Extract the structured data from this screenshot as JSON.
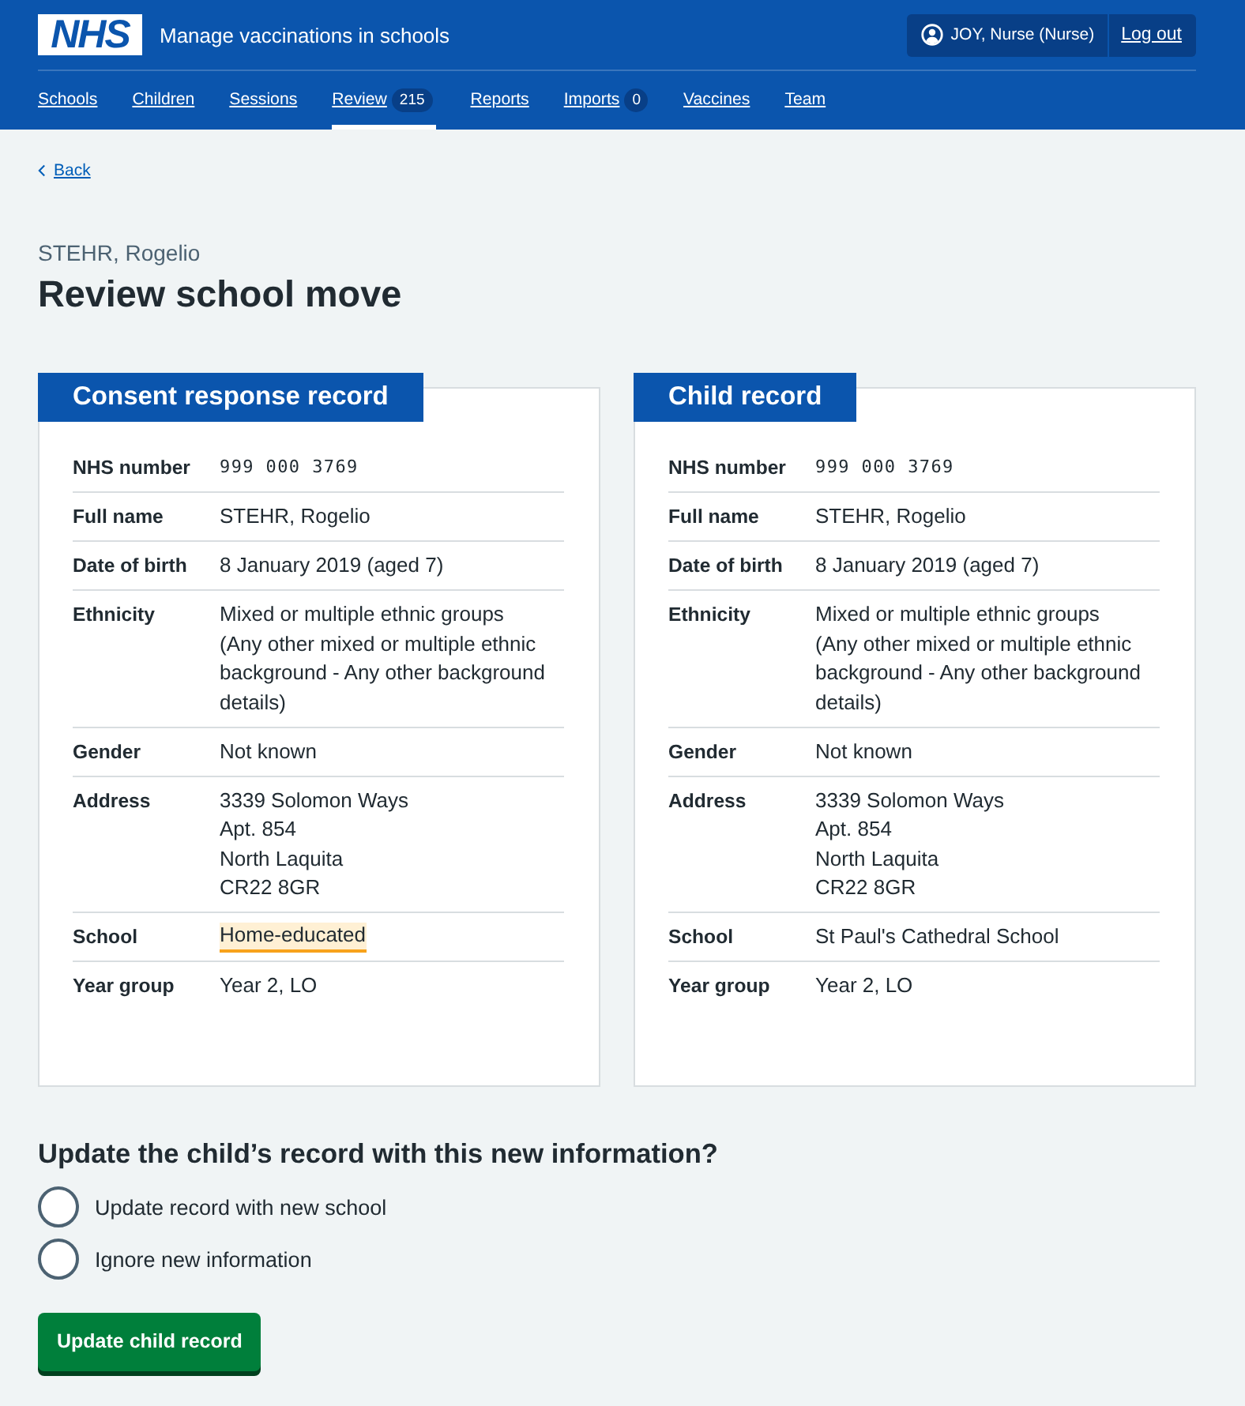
{
  "header": {
    "logo": "NHS",
    "service_name": "Manage vaccinations in schools",
    "account": {
      "user": "JOY, Nurse (Nurse)",
      "logout": "Log out"
    }
  },
  "nav": [
    {
      "label": "Schools",
      "selected": false
    },
    {
      "label": "Children",
      "selected": false
    },
    {
      "label": "Sessions",
      "selected": false
    },
    {
      "label": "Review",
      "count": "215",
      "selected": true
    },
    {
      "label": "Reports",
      "selected": false
    },
    {
      "label": "Imports",
      "count": "0",
      "selected": false
    },
    {
      "label": "Vaccines",
      "selected": false
    },
    {
      "label": "Team",
      "selected": false
    }
  ],
  "back_link": "Back",
  "caption": "STEHR, Rogelio",
  "title": "Review school move",
  "records": [
    {
      "heading": "Consent response record",
      "rows": [
        {
          "key": "NHS number",
          "kind": "number",
          "value": "999 000 3769",
          "highlighted": false
        },
        {
          "key": "Full name",
          "kind": "text",
          "value": "STEHR, Rogelio",
          "highlighted": false
        },
        {
          "key": "Date of birth",
          "kind": "text",
          "value": "8 January 2019 (aged 7)",
          "highlighted": false
        },
        {
          "key": "Ethnicity",
          "kind": "text",
          "value": "Mixed or multiple ethnic groups (Any other mixed or multiple ethnic background - Any other background details)",
          "highlighted": false
        },
        {
          "key": "Gender",
          "kind": "text",
          "value": "Not known",
          "highlighted": false
        },
        {
          "key": "Address",
          "kind": "lines",
          "lines": [
            "3339 Solomon Ways",
            "Apt. 854",
            "North Laquita",
            "CR22 8GR"
          ],
          "highlighted": false
        },
        {
          "key": "School",
          "kind": "text",
          "value": "Home-educated",
          "highlighted": true
        },
        {
          "key": "Year group",
          "kind": "text",
          "value": "Year 2, LO",
          "highlighted": false
        }
      ]
    },
    {
      "heading": "Child record",
      "rows": [
        {
          "key": "NHS number",
          "kind": "number",
          "value": "999 000 3769",
          "highlighted": false
        },
        {
          "key": "Full name",
          "kind": "text",
          "value": "STEHR, Rogelio",
          "highlighted": false
        },
        {
          "key": "Date of birth",
          "kind": "text",
          "value": "8 January 2019 (aged 7)",
          "highlighted": false
        },
        {
          "key": "Ethnicity",
          "kind": "text",
          "value": "Mixed or multiple ethnic groups (Any other mixed or multiple ethnic background - Any other background details)",
          "highlighted": false
        },
        {
          "key": "Gender",
          "kind": "text",
          "value": "Not known",
          "highlighted": false
        },
        {
          "key": "Address",
          "kind": "lines",
          "lines": [
            "3339 Solomon Ways",
            "Apt. 854",
            "North Laquita",
            "CR22 8GR"
          ],
          "highlighted": false
        },
        {
          "key": "School",
          "kind": "text",
          "value": "St Paul's Cathedral School",
          "highlighted": false
        },
        {
          "key": "Year group",
          "kind": "text",
          "value": "Year 2, LO",
          "highlighted": false
        }
      ]
    }
  ],
  "question": {
    "legend": "Update the child’s record with this new information?",
    "options": [
      {
        "label": "Update record with new school",
        "selected": false
      },
      {
        "label": "Ignore new information",
        "selected": false
      }
    ]
  },
  "submit": "Update child record"
}
